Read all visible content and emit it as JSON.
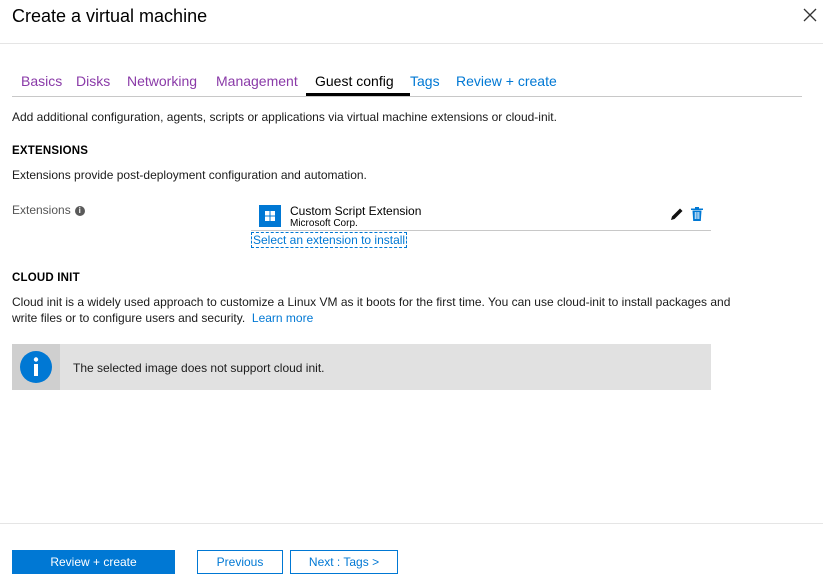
{
  "window": {
    "title": "Create a virtual machine"
  },
  "tabs": [
    {
      "label": "Basics"
    },
    {
      "label": "Disks"
    },
    {
      "label": "Networking"
    },
    {
      "label": "Management"
    },
    {
      "label": "Guest config"
    },
    {
      "label": "Tags"
    },
    {
      "label": "Review + create"
    }
  ],
  "active_tab": "Guest config",
  "intro": "Add additional configuration, agents, scripts or applications via virtual machine extensions or cloud-init.",
  "extensions_section": {
    "heading": "EXTENSIONS",
    "description": "Extensions provide post-deployment configuration and automation.",
    "field_label": "Extensions",
    "items": [
      {
        "name": "Custom Script Extension",
        "publisher": "Microsoft Corp."
      }
    ],
    "select_link": "Select an extension to install"
  },
  "cloud_init_section": {
    "heading": "CLOUD INIT",
    "description_line1": "Cloud init is a widely used approach to customize a Linux VM as it boots for the first time. You can use cloud-init to install packages and",
    "description_line2": "write files or to configure users and security.",
    "learn_more": "Learn more",
    "notice": "The selected image does not support cloud init."
  },
  "footer": {
    "review_create": "Review + create",
    "previous": "Previous",
    "next": "Next : Tags >"
  },
  "colors": {
    "accent": "#0078d4",
    "visited_tab": "#8a3aa8",
    "notice_bg": "#e1e1e1"
  },
  "icons": [
    "close-icon",
    "info-icon",
    "extension-icon",
    "edit-icon",
    "delete-icon",
    "notice-info-icon"
  ]
}
